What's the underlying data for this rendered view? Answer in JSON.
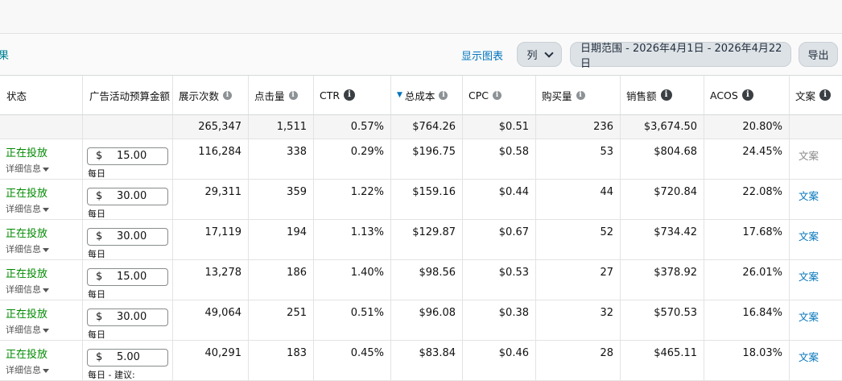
{
  "toolbar": {
    "results_fragment": "果",
    "show_chart": "显示图表",
    "columns_label": "列",
    "date_range": "日期范围 - 2026年4月1日 - 2026年4月22日",
    "export_label": "导出"
  },
  "table": {
    "headers": {
      "status": "状态",
      "budget": "广告活动预算金额",
      "impressions": "展示次数",
      "clicks": "点击量",
      "ctr": "CTR",
      "spend": "总成本",
      "cpc": "CPC",
      "orders": "购买量",
      "sales": "销售额",
      "acos": "ACOS",
      "creative": "文案"
    },
    "totals": {
      "impressions": "265,347",
      "clicks": "1,511",
      "ctr": "0.57%",
      "spend": "$764.26",
      "cpc": "$0.51",
      "orders": "236",
      "sales": "$3,674.50",
      "acos": "20.80%"
    },
    "rows": [
      {
        "status": "正在投放",
        "details": "详细信息",
        "currency": "$",
        "budget": "15.00",
        "budget_type": "每日",
        "impressions": "116,284",
        "clicks": "338",
        "ctr": "0.29%",
        "spend": "$196.75",
        "cpc": "$0.58",
        "orders": "53",
        "sales": "$804.68",
        "acos": "24.45%",
        "creative": "文案"
      },
      {
        "status": "正在投放",
        "details": "详细信息",
        "currency": "$",
        "budget": "30.00",
        "budget_type": "每日",
        "impressions": "29,311",
        "clicks": "359",
        "ctr": "1.22%",
        "spend": "$159.16",
        "cpc": "$0.44",
        "orders": "44",
        "sales": "$720.84",
        "acos": "22.08%",
        "creative": "文案"
      },
      {
        "status": "正在投放",
        "details": "详细信息",
        "currency": "$",
        "budget": "30.00",
        "budget_type": "每日",
        "impressions": "17,119",
        "clicks": "194",
        "ctr": "1.13%",
        "spend": "$129.87",
        "cpc": "$0.67",
        "orders": "52",
        "sales": "$734.42",
        "acos": "17.68%",
        "creative": "文案"
      },
      {
        "status": "正在投放",
        "details": "详细信息",
        "currency": "$",
        "budget": "15.00",
        "budget_type": "每日",
        "impressions": "13,278",
        "clicks": "186",
        "ctr": "1.40%",
        "spend": "$98.56",
        "cpc": "$0.53",
        "orders": "27",
        "sales": "$378.92",
        "acos": "26.01%",
        "creative": "文案"
      },
      {
        "status": "正在投放",
        "details": "详细信息",
        "currency": "$",
        "budget": "30.00",
        "budget_type": "每日",
        "impressions": "49,064",
        "clicks": "251",
        "ctr": "0.51%",
        "spend": "$96.08",
        "cpc": "$0.38",
        "orders": "32",
        "sales": "$570.53",
        "acos": "16.84%",
        "creative": "文案"
      },
      {
        "status": "正在投放",
        "details": "详细信息",
        "currency": "$",
        "budget": "5.00",
        "budget_type": "每日 - 建议:",
        "impressions": "40,291",
        "clicks": "183",
        "ctr": "0.45%",
        "spend": "$83.84",
        "cpc": "$0.46",
        "orders": "28",
        "sales": "$465.11",
        "acos": "18.03%",
        "creative": "文案"
      }
    ]
  }
}
